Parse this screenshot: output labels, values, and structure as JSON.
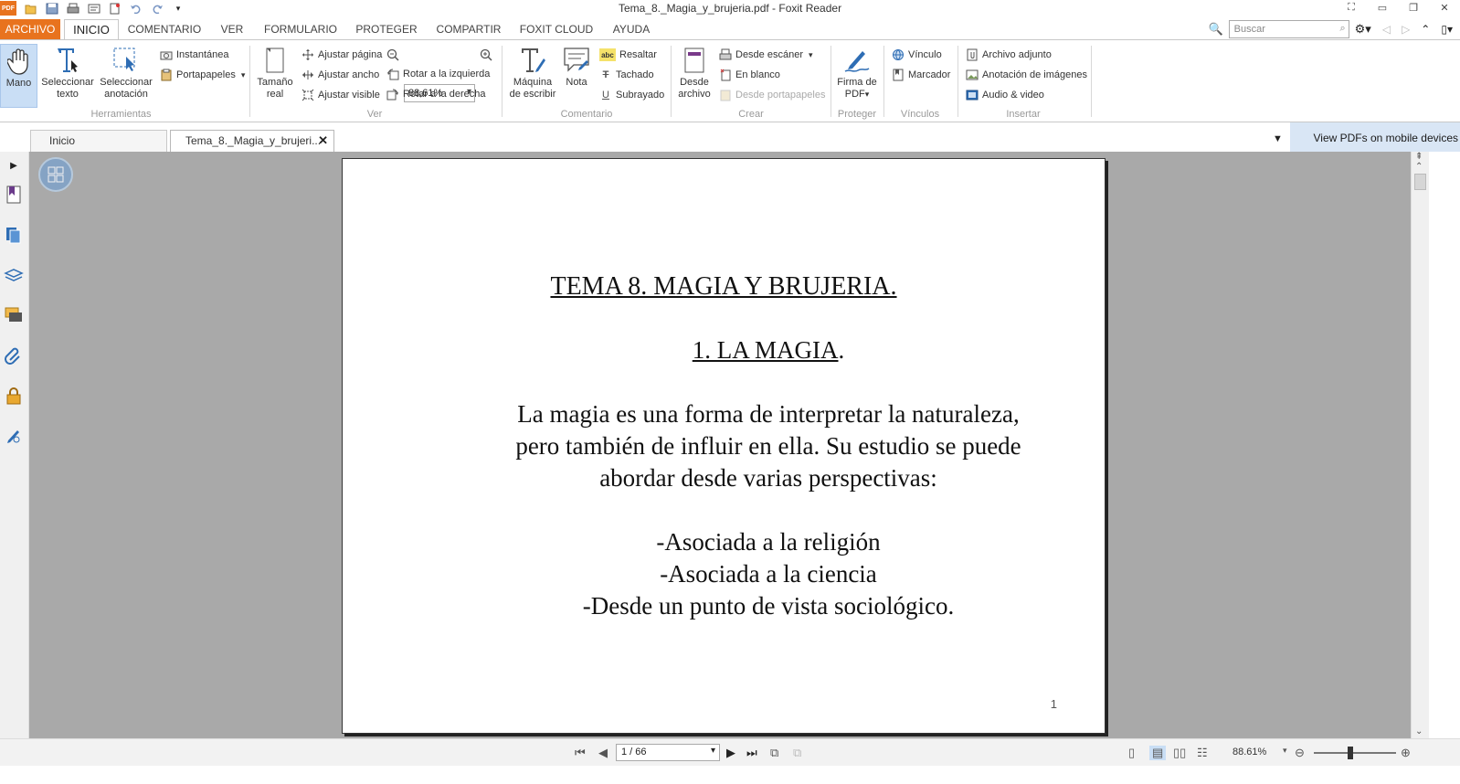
{
  "window": {
    "title": "Tema_8._Magia_y_brujeria.pdf - Foxit Reader",
    "logo_text": "PDF"
  },
  "menu": {
    "tabs": [
      "ARCHIVO",
      "INICIO",
      "COMENTARIO",
      "VER",
      "FORMULARIO",
      "PROTEGER",
      "COMPARTIR",
      "FOXIT CLOUD",
      "AYUDA"
    ],
    "active": "INICIO"
  },
  "search": {
    "placeholder": "Buscar"
  },
  "ribbon": {
    "herramientas": {
      "label": "Herramientas",
      "mano": "Mano",
      "seleccionar_texto": [
        "Seleccionar",
        "texto"
      ],
      "seleccionar_anotacion": [
        "Seleccionar",
        "anotación"
      ],
      "instantanea": "Instantánea",
      "portapapeles": "Portapapeles"
    },
    "ver": {
      "label": "Ver",
      "tamano_real": [
        "Tamaño",
        "real"
      ],
      "ajustar_pagina": "Ajustar página",
      "ajustar_ancho": "Ajustar ancho",
      "ajustar_visible": "Ajustar visible",
      "zoom": "88,61%",
      "rotar_izq": "Rotar a la izquierda",
      "rotar_der": "Rotar a la derecha"
    },
    "comentario": {
      "label": "Comentario",
      "maquina": [
        "Máquina",
        "de escribir"
      ],
      "nota": "Nota",
      "resaltar": "Resaltar",
      "tachado": "Tachado",
      "subrayado": "Subrayado"
    },
    "crear": {
      "label": "Crear",
      "desde_archivo": [
        "Desde",
        "archivo"
      ],
      "desde_escaner": "Desde escáner",
      "en_blanco": "En blanco",
      "desde_portapapeles": "Desde portapapeles"
    },
    "proteger": {
      "label": "Proteger",
      "firma": [
        "Firma de",
        "PDF"
      ]
    },
    "vinculos": {
      "label": "Vínculos",
      "vinculo": "Vínculo",
      "marcador": "Marcador"
    },
    "insertar": {
      "label": "Insertar",
      "archivo_adjunto": "Archivo adjunto",
      "anotacion_imagenes": "Anotación de imágenes",
      "audio_video": "Audio & video"
    }
  },
  "doc_tabs": {
    "home": "Inicio",
    "doc": "Tema_8._Magia_y_brujeri...",
    "close": "✕"
  },
  "promo": "View PDFs on mobile devices",
  "page": {
    "title": "TEMA 8. MAGIA Y BRUJERIA.",
    "section_num": "1. LA MAGIA",
    "section_punct": ".",
    "para": [
      "La magia es una forma de interpretar la naturaleza,",
      "pero también de influir en ella. Su estudio se puede",
      "abordar desde varias perspectivas:"
    ],
    "list": [
      "-Asociada a la religión",
      "-Asociada a la ciencia",
      "-Desde un punto de vista sociológico."
    ],
    "number": "1"
  },
  "status": {
    "page_indicator": "1 / 66",
    "zoom": "88.61%"
  },
  "colors": {
    "accent": "#e8731e",
    "viewer_bg": "#a9a9a9",
    "promo_bg": "#d9e6f5"
  }
}
